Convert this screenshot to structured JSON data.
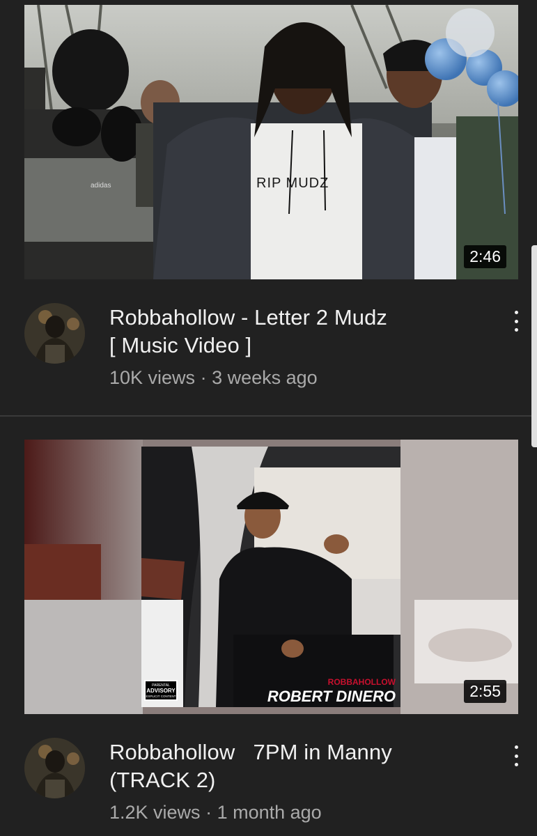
{
  "videos": [
    {
      "title_line1": "Robbahollow - Letter 2 Mudz",
      "title_line2": "[ Music Video ]",
      "views": "10K views",
      "age": "3 weeks ago",
      "duration": "2:46",
      "thumbnail_text": "RIP MUDZ",
      "thumbnail_brand": "adidas"
    },
    {
      "title_line1": "Robbahollow   7PM in Manny",
      "title_line2": "(TRACK 2)",
      "views": "1.2K views",
      "age": "1 month ago",
      "duration": "2:55",
      "cover_artist": "ROBBAHOLLOW",
      "cover_title": "ROBERT DINERO",
      "advisory_line1": "PARENTAL",
      "advisory_line2": "ADVISORY",
      "advisory_line3": "EXPLICIT CONTENT"
    }
  ],
  "separator": "·",
  "colors": {
    "background": "#212121",
    "title": "#f1f1f1",
    "subtext": "#aaaaaa",
    "duration_bg": "#000000",
    "cover_red": "#c8102e"
  },
  "icons": {
    "more": "more-vert-icon"
  }
}
